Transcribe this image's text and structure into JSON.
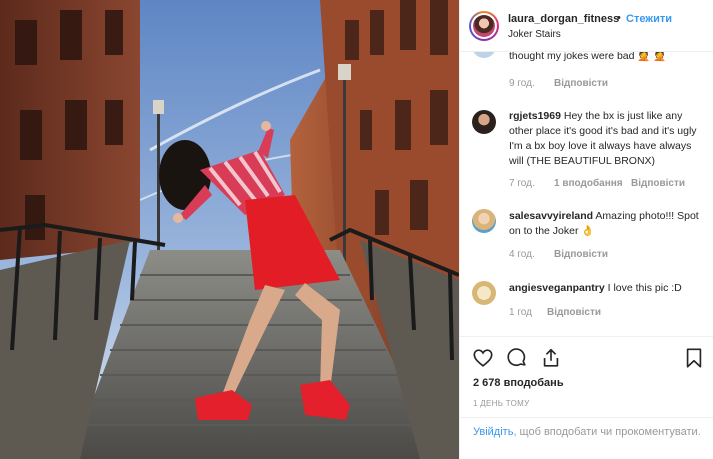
{
  "post": {
    "username": "laura_dorgan_fitness",
    "separator": "•",
    "follow_label": "Стежити",
    "location": "Joker Stairs"
  },
  "comments": {
    "partial": {
      "text": "thought my jokes were bad 🤦 🤦",
      "time": "9 год.",
      "reply_label": "Відповісти"
    },
    "items": [
      {
        "username": "rgjets1969",
        "text": "Hey the bx is just like any other place it's good it's bad and it's ugly I'm a bx boy love it always have always will (THE BEAUTIFUL BRONX)",
        "time": "7 год.",
        "likes": "1 вподобання",
        "reply_label": "Відповісти"
      },
      {
        "username": "salesavvyireland",
        "text": "Amazing photo!!! Spot on to the Joker 👌",
        "time": "4 год.",
        "likes": "",
        "reply_label": "Відповісти"
      },
      {
        "username": "angiesveganpantry",
        "text": "I love this pic :D",
        "time": "1 год",
        "likes": "",
        "reply_label": "Відповісти"
      }
    ]
  },
  "actions": {
    "like_icon": "heart-icon",
    "comment_icon": "comment-icon",
    "share_icon": "share-icon",
    "save_icon": "bookmark-icon",
    "likes_count": "2 678 вподобань",
    "posted": "1 ДЕНЬ ТОМУ"
  },
  "login": {
    "link_text": "Увійдіть",
    "rest_text": ", щоб вподобати чи прокоментувати."
  },
  "colors": {
    "link": "#3897f0",
    "muted": "#999999",
    "text": "#262626"
  }
}
